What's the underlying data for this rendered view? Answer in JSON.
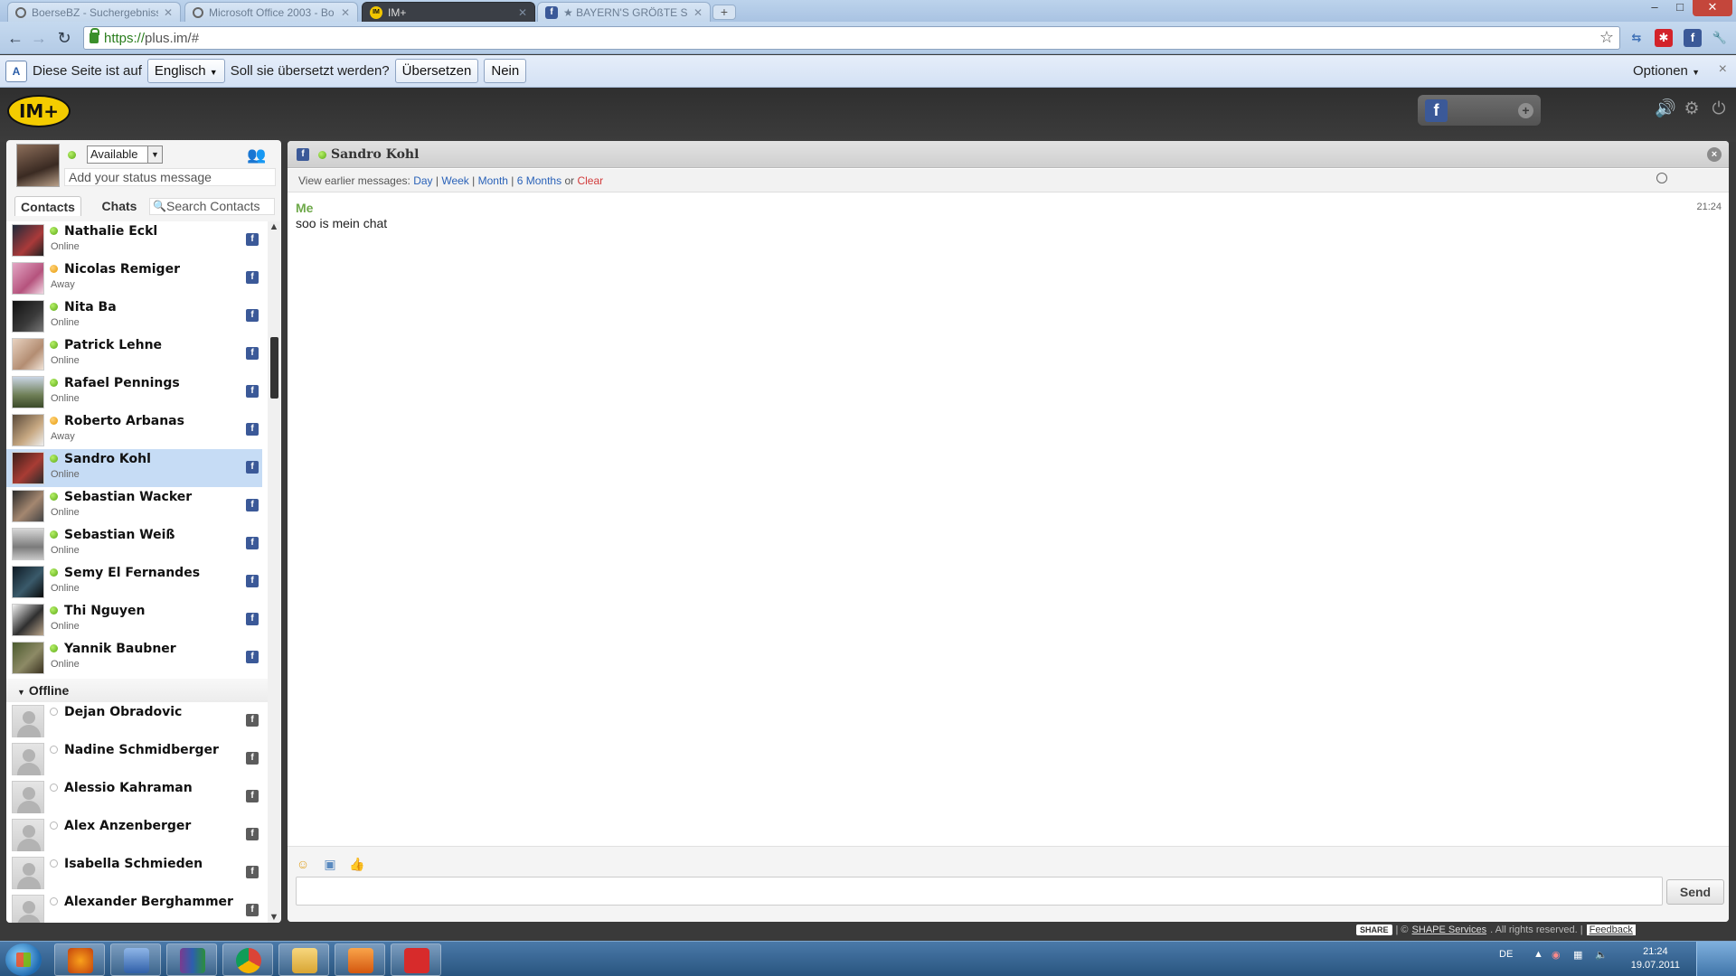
{
  "browser": {
    "tabs": [
      {
        "label": "BoerseBZ - Suchergebnisse",
        "favicon": "globe-icon",
        "active": false
      },
      {
        "label": "Microsoft Office 2003 - Bo",
        "favicon": "globe-icon",
        "active": false
      },
      {
        "label": "IM+",
        "favicon": "implus-icon",
        "active": true
      },
      {
        "label": "★ BAYERN'S GRÖßTE SCH",
        "favicon": "facebook-icon",
        "active": false
      }
    ],
    "new_tab": "+",
    "url_scheme": "https://",
    "url_rest": "plus.im/#",
    "window_controls": {
      "minimize": "–",
      "maximize": "□",
      "close": "✕"
    }
  },
  "translate_bar": {
    "prefix": "Diese Seite ist auf",
    "language": "Englisch",
    "question": "Soll sie übersetzt werden?",
    "translate_button": "Übersetzen",
    "no_button": "Nein",
    "options": "Optionen",
    "close": "×"
  },
  "header": {
    "logo_text": "IM+",
    "fb_letter": "f"
  },
  "me": {
    "status": "Available",
    "status_placeholder": "Add your status message"
  },
  "panel_tabs": {
    "contacts": "Contacts",
    "chats": "Chats",
    "search_placeholder": "Search Contacts"
  },
  "contacts_online": [
    {
      "name": "Nathalie Eckl",
      "status": "Online",
      "presence": "online"
    },
    {
      "name": "Nicolas Remiger",
      "status": "Away",
      "presence": "away"
    },
    {
      "name": "Nita Ba",
      "status": "Online",
      "presence": "online"
    },
    {
      "name": "Patrick Lehne",
      "status": "Online",
      "presence": "online"
    },
    {
      "name": "Rafael Pennings",
      "status": "Online",
      "presence": "online"
    },
    {
      "name": "Roberto Arbanas",
      "status": "Away",
      "presence": "away"
    },
    {
      "name": "Sandro Kohl",
      "status": "Online",
      "presence": "online",
      "selected": true
    },
    {
      "name": "Sebastian Wacker",
      "status": "Online",
      "presence": "online"
    },
    {
      "name": "Sebastian Weiß",
      "status": "Online",
      "presence": "online"
    },
    {
      "name": "Semy El Fernandes",
      "status": "Online",
      "presence": "online"
    },
    {
      "name": "Thi Nguyen",
      "status": "Online",
      "presence": "online"
    },
    {
      "name": "Yannik Baubner",
      "status": "Online",
      "presence": "online"
    }
  ],
  "offline_group": "Offline",
  "contacts_offline": [
    {
      "name": "Dejan Obradovic"
    },
    {
      "name": "Nadine Schmidberger"
    },
    {
      "name": "Alessio Kahraman"
    },
    {
      "name": "Alex Anzenberger"
    },
    {
      "name": "Isabella Schmieden"
    },
    {
      "name": "Alexander Berghammer"
    }
  ],
  "chat": {
    "title": "Sandro Kohl",
    "history_label": "View earlier messages:",
    "history_day": "Day",
    "history_week": "Week",
    "history_month": "Month",
    "history_6months": "6 Months",
    "history_or": "or",
    "history_clear": "Clear",
    "messages": [
      {
        "sender": "Me",
        "text": "soo is mein chat",
        "time": "21:24"
      }
    ],
    "send": "Send"
  },
  "footer": {
    "share": "SHARE",
    "copyright_prefix": "| ©",
    "company": "SHAPE Services",
    "rights": ". All rights reserved. |",
    "feedback": "Feedback"
  },
  "taskbar": {
    "language": "DE",
    "time": "21:24",
    "date": "19.07.2011"
  },
  "colors": {
    "brand_yellow": "#f4cc00",
    "facebook_blue": "#3b5998",
    "online_green": "#5aa913",
    "away_orange": "#e79a06",
    "selected_row": "#c6dcf5"
  }
}
